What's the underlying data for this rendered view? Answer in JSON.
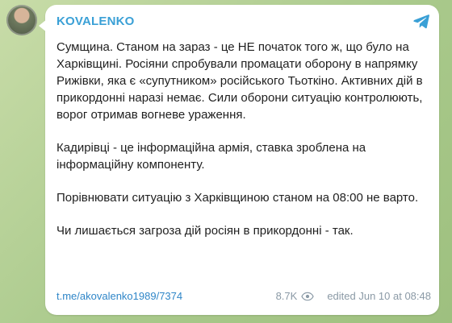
{
  "channel": {
    "name": "KOVALENKO"
  },
  "message": {
    "paragraphs": [
      "Сумщина. Станом на зараз - це НЕ початок того ж, що було на Харківщині. Росіяни спробували промацати оборону в напрямку Рижівки, яка є «супутником» російського Тьоткіно. Активних дій в прикордонні наразі немає. Сили оборони ситуацію контролюють, ворог отримав вогневе ураження.",
      "Кадирівці - це інформаційна армія, ставка зроблена на інформаційну компоненту.",
      "Порівнювати ситуацію з Харківщиною станом на 08:00 не варто.",
      "Чи лишається загроза дій росіян в прикордонні - так."
    ]
  },
  "footer": {
    "link": "t.me/akovalenko1989/7374",
    "views": "8.7K",
    "status": "edited  Jun 10 at 08:48"
  },
  "icons": {
    "telegram": "telegram-icon",
    "eye": "eye-icon"
  },
  "colors": {
    "accent": "#3aa0d6",
    "link": "#2f86c8",
    "meta": "#8b9aa6",
    "background": "#b9d39d"
  }
}
